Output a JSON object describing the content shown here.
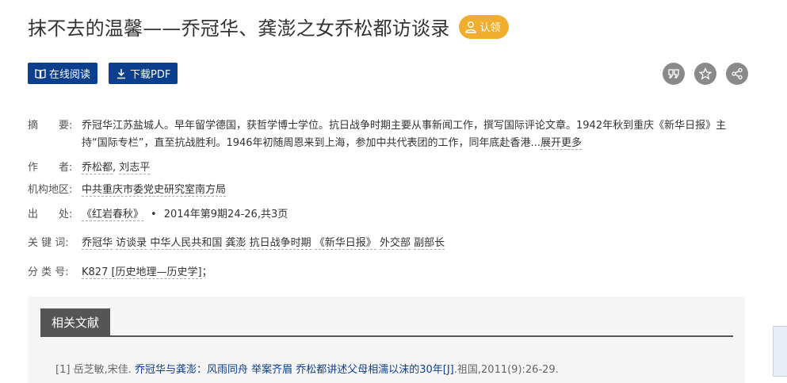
{
  "header": {
    "title": "抹不去的温馨——乔冠华、龚澎之女乔松都访谈录",
    "claim_label": "认领"
  },
  "actions": {
    "read_online": "在线阅读",
    "download_pdf": "下载PDF"
  },
  "share_icons": [
    "quote-icon",
    "star-icon",
    "share-icon"
  ],
  "meta": {
    "abstract_label": "摘　　要:",
    "abstract": "乔冠华江苏盐城人。早年留学德国，获哲学博士学位。抗日战争时期主要从事新闻工作，撰写国际评论文章。1942年秋到重庆《新华日报》主持“国际专栏”，直至抗战胜利。1946年初随周恩来到上海，参加中共代表团的工作，同年底赴香港...",
    "expand": "展开更多",
    "author_label": "作　　者:",
    "authors": [
      "乔松都",
      "刘志平"
    ],
    "author_sep": ",",
    "institution_label": "机构地区:",
    "institution": "中共重庆市委党史研究室南方局",
    "source_label": "出　　处:",
    "journal": "《红岩春秋》",
    "dot": "•",
    "issue": "2014年第9期24-26,共3页",
    "keywords_label": "关 键 词:",
    "keywords": [
      "乔冠华",
      "访谈录",
      "中华人民共和国",
      "龚澎",
      "抗日战争时期",
      "《新华日报》",
      "外交部",
      "副部长"
    ],
    "class_label": "分 类 号:",
    "class_code": "K827 [历史地理—历史学]",
    "class_suffix": "；"
  },
  "related": {
    "heading": "相关文献",
    "items": [
      {
        "index": "[1]",
        "authors": "岳芝敏,宋佳.",
        "title": "乔冠华与龚澎：风雨同舟 举案齐眉 乔松都讲述父母相濡以沫的30年[J]",
        "source": ".祖国,2011(9):26-29."
      }
    ]
  },
  "colors": {
    "primary_button": "#0d3f8f",
    "claim": "#f1ad2d",
    "icon_circle": "#8a8a8a",
    "related_tab": "#555555",
    "link": "#0d3f8f"
  }
}
